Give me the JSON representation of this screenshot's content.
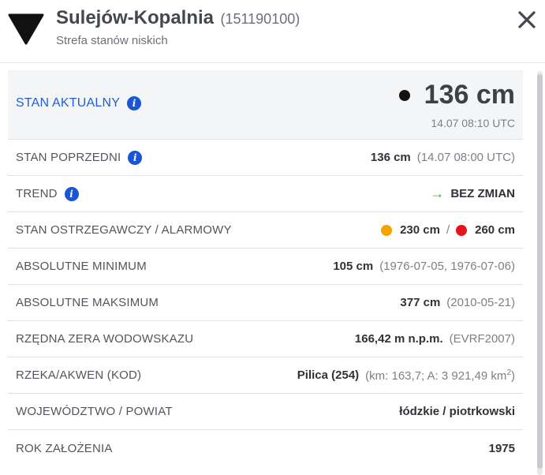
{
  "header": {
    "title": "Sulejów-Kopalnia",
    "code": "(151190100)",
    "subtitle": "Strefa stanów niskich",
    "logo_icon": "down-triangle-icon",
    "close_icon": "close-icon"
  },
  "current": {
    "label": "STAN AKTUALNY",
    "value": "136 cm",
    "timestamp": "14.07 08:10 UTC",
    "dot_color": "#111111"
  },
  "rows": {
    "previous": {
      "label": "STAN POPRZEDNI",
      "value": "136 cm",
      "detail": "(14.07 08:00 UTC)"
    },
    "trend": {
      "label": "TREND",
      "value": "BEZ ZMIAN",
      "arrow": "→",
      "arrow_color": "#3cae5a"
    },
    "warning": {
      "label": "STAN OSTRZEGAWCZY / ALARMOWY",
      "warning_value": "230 cm",
      "separator": "/",
      "alarm_value": "260 cm",
      "warning_color": "#f5a300",
      "alarm_color": "#e8141c"
    },
    "abs_min": {
      "label": "ABSOLUTNE MINIMUM",
      "value": "105 cm",
      "detail": "(1976-07-05, 1976-07-06)"
    },
    "abs_max": {
      "label": "ABSOLUTNE MAKSIMUM",
      "value": "377 cm",
      "detail": "(2010-05-21)"
    },
    "gauge_zero": {
      "label": "RZĘDNA ZERA WODOWSKAZU",
      "value": "166,42 m n.p.m.",
      "detail": "(EVRF2007)"
    },
    "river": {
      "label": "RZEKA/AKWEN (KOD)",
      "value": "Pilica (254)",
      "detail": "(km: 163,7; A: 3 921,49 km",
      "detail_sup": "2",
      "detail_end": ")"
    },
    "region": {
      "label": "WOJEWÓDZTWO / POWIAT",
      "value": "łódzkie / piotrkowski"
    },
    "founded": {
      "label": "ROK ZAŁOŻENIA",
      "value": "1975"
    }
  },
  "colors": {
    "accent": "#1f5fd6",
    "info_badge": "#1a55d6"
  }
}
